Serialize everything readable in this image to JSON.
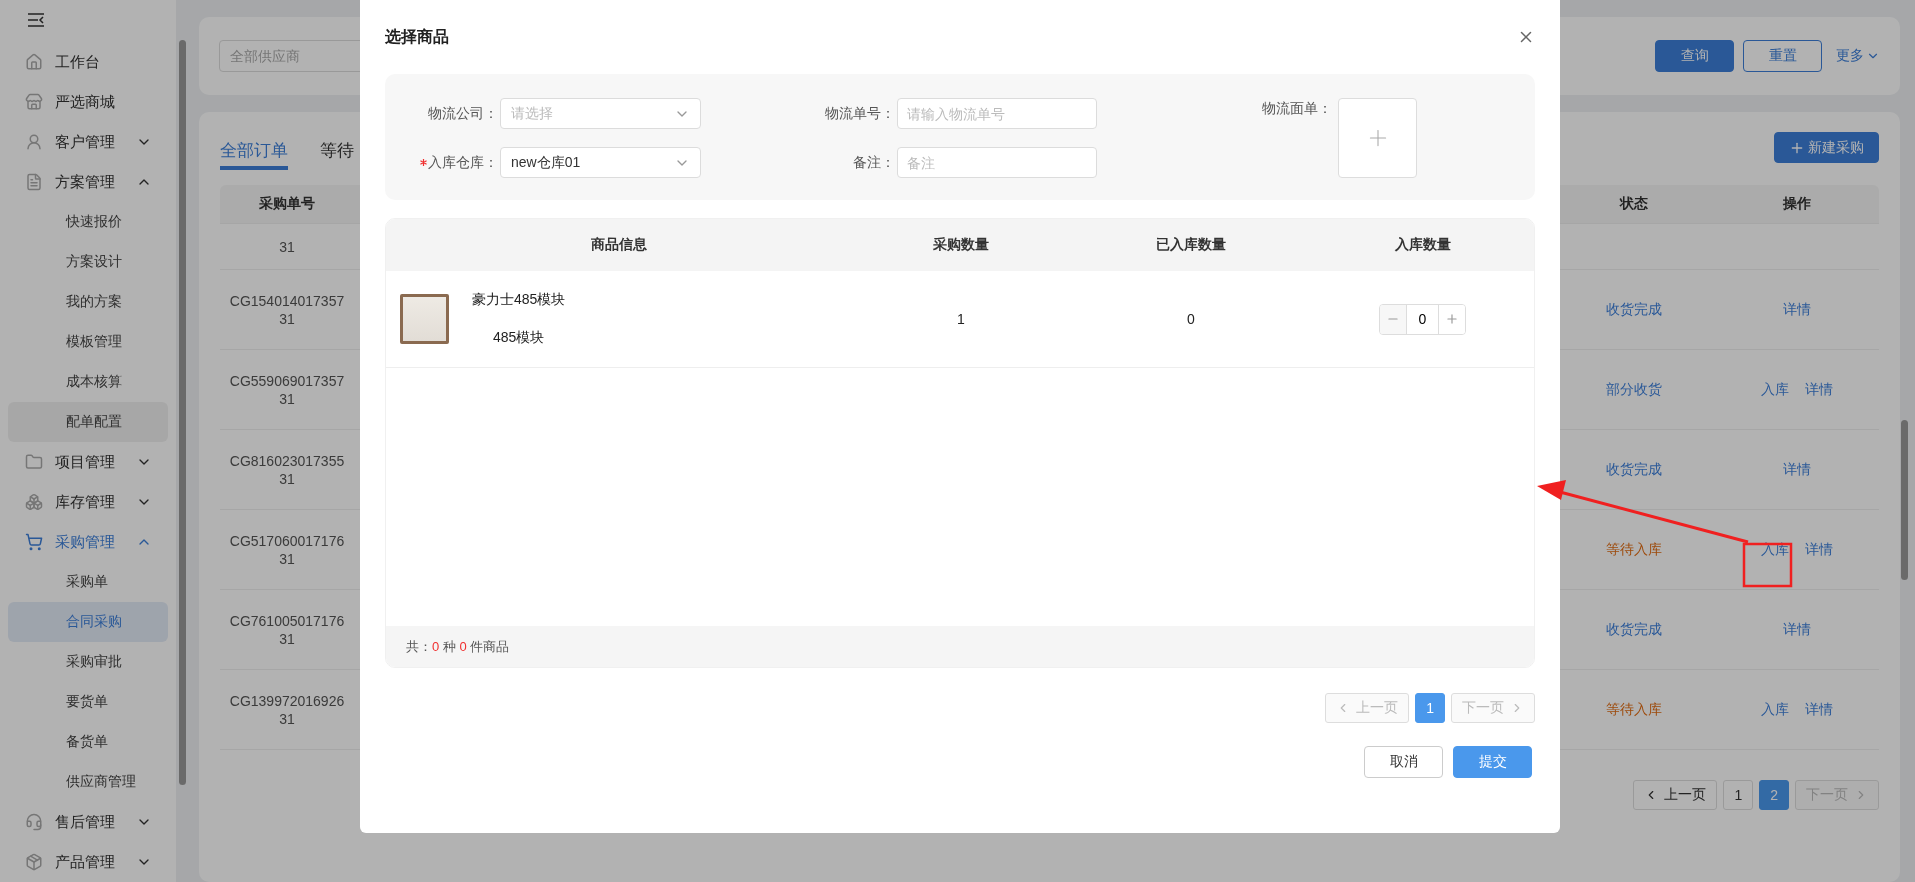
{
  "sidebar": {
    "items": [
      {
        "label": "工作台",
        "active": false
      },
      {
        "label": "严选商城",
        "active": false
      },
      {
        "label": "客户管理",
        "active": false,
        "expanded": false
      },
      {
        "label": "方案管理",
        "active": false,
        "expanded": true,
        "children": [
          {
            "label": "快速报价",
            "selected": false,
            "hovered": false
          },
          {
            "label": "方案设计",
            "selected": false,
            "hovered": false
          },
          {
            "label": "我的方案",
            "selected": false,
            "hovered": false
          },
          {
            "label": "模板管理",
            "selected": false,
            "hovered": false
          },
          {
            "label": "成本核算",
            "selected": false,
            "hovered": false
          },
          {
            "label": "配单配置",
            "selected": false,
            "hovered": true
          }
        ]
      },
      {
        "label": "项目管理",
        "active": false,
        "expanded": false
      },
      {
        "label": "库存管理",
        "active": false,
        "expanded": false
      },
      {
        "label": "采购管理",
        "active": true,
        "expanded": true,
        "children": [
          {
            "label": "采购单",
            "selected": false,
            "hovered": false
          },
          {
            "label": "合同采购",
            "selected": true,
            "hovered": false
          },
          {
            "label": "采购审批",
            "selected": false,
            "hovered": false
          },
          {
            "label": "要货单",
            "selected": false,
            "hovered": false
          },
          {
            "label": "备货单",
            "selected": false,
            "hovered": false
          },
          {
            "label": "供应商管理",
            "selected": false,
            "hovered": false
          }
        ]
      },
      {
        "label": "售后管理",
        "active": false,
        "expanded": false
      },
      {
        "label": "产品管理",
        "active": false,
        "expanded": false
      }
    ]
  },
  "filter": {
    "supplier_placeholder": "全部供应商",
    "buttons": [
      {
        "label": "查询",
        "kind": "primary"
      },
      {
        "label": "重置",
        "kind": "outline"
      }
    ],
    "more": "更多"
  },
  "tabs": [
    {
      "label": "全部订单",
      "selected": true
    },
    {
      "label": "等待",
      "selected": false
    }
  ],
  "new_button": "新建采购",
  "orders": {
    "columns": [
      "采购单号",
      "状态",
      "操作"
    ],
    "rows": [
      {
        "id_lines": [
          "31"
        ],
        "actions": []
      },
      {
        "id_lines": [
          "CG154014017357",
          "31"
        ],
        "status": "收货完成",
        "color": "#2b5998",
        "actions": [
          "详情"
        ]
      },
      {
        "id_lines": [
          "CG559069017357",
          "31"
        ],
        "status": "部分收货",
        "color": "#2b5998",
        "actions": [
          "入库",
          "详情"
        ]
      },
      {
        "id_lines": [
          "CG816023017355",
          "31"
        ],
        "status": "收货完成",
        "color": "#2b5998",
        "actions": [
          "详情"
        ]
      },
      {
        "id_lines": [
          "CG517060017176",
          "31"
        ],
        "status": "等待入库",
        "color": "#9d4a0b",
        "actions": [
          "入库",
          "详情"
        ]
      },
      {
        "id_lines": [
          "CG761005017176",
          "31"
        ],
        "status": "收货完成",
        "color": "#2b5998",
        "actions": [
          "详情"
        ]
      },
      {
        "id_lines": [
          "CG139972016926",
          "31"
        ],
        "status": "等待入库",
        "color": "#9d4a0b",
        "actions": [
          "入库",
          "详情"
        ]
      }
    ]
  },
  "pagination": {
    "prev": "上一页",
    "next": "下一页",
    "next_disabled": true,
    "pages": [
      {
        "label": "1",
        "selected": false
      },
      {
        "label": "2",
        "selected": true
      }
    ]
  },
  "dialog": {
    "title": "选择商品",
    "form": {
      "company": {
        "label": "物流公司：",
        "placeholder": "请选择"
      },
      "number": {
        "label": "物流单号：",
        "placeholder": "请输入物流单号"
      },
      "warehouse": {
        "label": "入库仓库：",
        "required": true,
        "value": "new仓库01"
      },
      "note": {
        "label": "备注：",
        "placeholder": "备注"
      },
      "slip": {
        "label": "物流面单："
      }
    },
    "table": {
      "columns": [
        "商品信息",
        "采购数量",
        "已入库数量",
        "入库数量"
      ],
      "rows": [
        {
          "name": "豪力士485模块",
          "spec": "485模块",
          "ordered": "1",
          "received": "0",
          "quantity": "0"
        }
      ],
      "summary": {
        "prefix": "共：",
        "kinds": "0",
        "mid": "种",
        "count": "0",
        "suffix": "件商品"
      }
    },
    "pagination": {
      "prev": "上一页",
      "next": "下一页",
      "prev_disabled": true,
      "next_disabled": true,
      "pages": [
        {
          "label": "1",
          "selected": true
        }
      ]
    },
    "buttons": [
      {
        "label": "取消",
        "kind": "outline"
      },
      {
        "label": "提交",
        "kind": "primary"
      }
    ]
  }
}
